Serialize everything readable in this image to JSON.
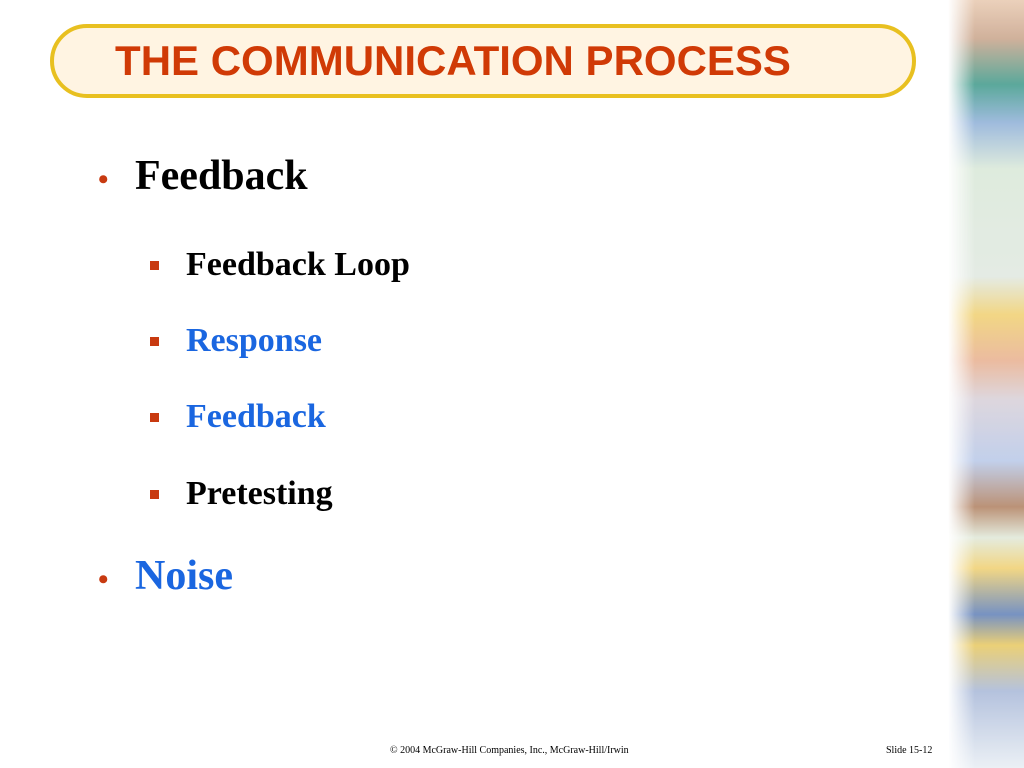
{
  "title": "THE COMMUNICATION PROCESS",
  "bullets": [
    {
      "text": "Feedback",
      "color": "#000000",
      "sub": [
        {
          "text": "Feedback Loop",
          "color": "#000000"
        },
        {
          "text": "Response",
          "color": "#1a66e0"
        },
        {
          "text": "Feedback",
          "color": "#1a66e0"
        },
        {
          "text": "Pretesting",
          "color": "#000000"
        }
      ]
    },
    {
      "text": "Noise",
      "color": "#1a66e0",
      "sub": []
    }
  ],
  "footer": {
    "copyright": "© 2004 McGraw-Hill Companies, Inc., McGraw-Hill/Irwin",
    "slide_number": "Slide 15-12"
  },
  "colors": {
    "title": "#d03a06",
    "pill_border": "#e8c020",
    "bullet": "#c83a10",
    "highlight": "#1a66e0"
  }
}
